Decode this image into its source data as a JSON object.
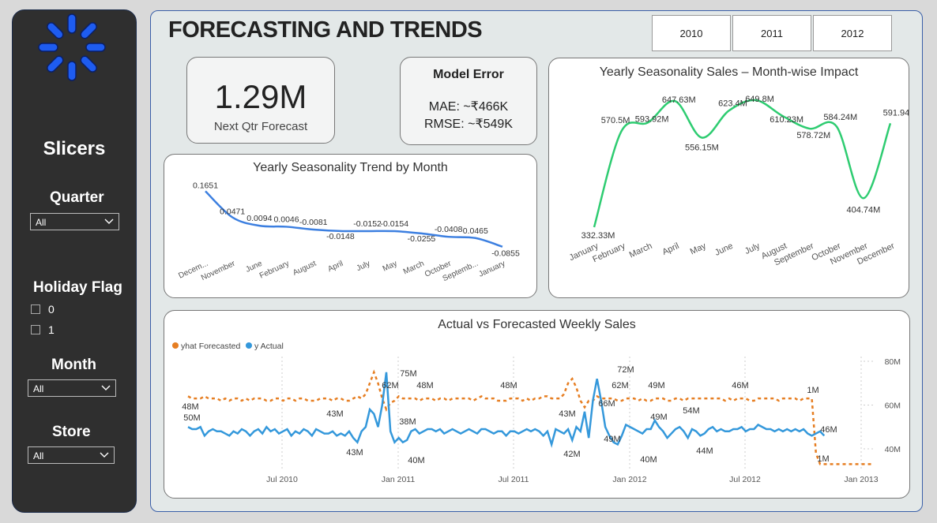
{
  "sidebar": {
    "title": "Slicers",
    "quarter": {
      "label": "Quarter",
      "value": "All"
    },
    "holiday": {
      "label": "Holiday Flag",
      "options": [
        "0",
        "1"
      ]
    },
    "month": {
      "label": "Month",
      "value": "All"
    },
    "store": {
      "label": "Store",
      "value": "All"
    }
  },
  "header": {
    "title": "FORECASTING AND TRENDS",
    "years": [
      "2010",
      "2011",
      "2012"
    ]
  },
  "kpi": {
    "value": "1.29M",
    "label": "Next Qtr Forecast"
  },
  "model_error": {
    "title": "Model Error",
    "mae": "MAE: ~₹466K",
    "rmse": "RMSE: ~₹549K"
  },
  "colors": {
    "accent_blue": "#3c7fe0",
    "green": "#2ecc71",
    "orange": "#e67e22",
    "actual_blue": "#3498db",
    "logo_blue": "#1e5cf0"
  },
  "chart_data": [
    {
      "type": "line",
      "title": "Yearly Seasonality Trend by Month",
      "categories": [
        "Decem...",
        "November",
        "June",
        "February",
        "August",
        "April",
        "July",
        "May",
        "March",
        "October",
        "Septemb...",
        "January"
      ],
      "values": [
        0.1651,
        0.0471,
        0.0094,
        0.0046,
        -0.0081,
        -0.0148,
        -0.0152,
        -0.0154,
        -0.0255,
        -0.0408,
        -0.0465,
        -0.0855
      ],
      "data_labels": [
        "0.1651",
        "0.0471",
        "0.0094",
        "0.0046",
        "-0.0081",
        "-0.0148",
        "-0.0152",
        "-0.0154",
        "-0.0255",
        "-0.0408",
        "0.0465",
        "-0.0855"
      ]
    },
    {
      "type": "line",
      "title": "Yearly Seasonality Sales – Month-wise Impact",
      "categories": [
        "January",
        "February",
        "March",
        "April",
        "May",
        "June",
        "July",
        "August",
        "September",
        "October",
        "November",
        "December"
      ],
      "values": [
        332.33,
        570.5,
        593.92,
        647.63,
        556.15,
        623.4,
        649.8,
        610.23,
        578.72,
        584.24,
        404.74,
        591.94
      ],
      "data_labels": [
        "332.33M",
        "570.5M",
        "593.92M",
        "647.63M",
        "556.15M",
        "623.4M",
        "649.8M",
        "610.23M",
        "578.72M",
        "584.24M",
        "404.74M",
        "591.94M"
      ]
    },
    {
      "type": "line",
      "title": "Actual vs Forecasted Weekly Sales",
      "legend": [
        "yhat Forecasted",
        "y Actual"
      ],
      "x_ticks": [
        "Jul 2010",
        "Jan 2011",
        "Jul 2011",
        "Jan 2012",
        "Jul 2012",
        "Jan 2013"
      ],
      "y_ticks_right": [
        "80M",
        "60M",
        "40M"
      ],
      "ylim": [
        35,
        82
      ],
      "series": [
        {
          "name": "yhat Forecasted",
          "values": [
            64,
            63,
            63,
            63,
            64,
            63,
            63,
            63,
            62,
            63,
            62,
            63,
            63,
            62,
            63,
            62,
            63,
            63,
            63,
            62,
            62,
            63,
            63,
            62,
            63,
            63,
            62,
            63,
            63,
            62,
            62,
            62,
            63,
            63,
            63,
            62,
            63,
            63,
            62,
            62,
            63,
            64,
            63,
            65,
            70,
            75,
            70,
            63,
            58,
            61,
            62,
            64,
            63,
            63,
            63,
            63,
            62,
            63,
            63,
            63,
            62,
            63,
            63,
            62,
            63,
            63,
            63,
            63,
            63,
            62,
            63,
            64,
            63,
            63,
            63,
            62,
            62,
            62,
            63,
            63,
            63,
            62,
            63,
            62,
            63,
            63,
            64,
            64,
            63,
            63,
            63,
            65,
            70,
            72,
            68,
            62,
            59,
            62,
            62,
            64,
            63,
            63,
            63,
            63,
            62,
            62,
            63,
            63,
            63,
            62,
            63,
            62,
            62,
            63,
            63,
            63,
            62,
            62,
            63,
            63,
            62,
            63,
            63,
            63,
            63,
            63,
            63,
            63,
            63,
            63,
            62,
            63,
            62,
            63,
            63,
            63,
            62,
            62,
            63,
            63,
            63,
            63,
            63,
            62,
            63,
            63,
            63,
            63,
            62,
            63,
            63,
            63,
            38,
            33,
            33,
            33,
            33,
            33,
            33,
            33,
            33,
            33,
            33,
            33,
            33,
            33,
            33
          ],
          "labels": [
            "48M",
            "43M",
            "62M",
            "48M",
            "48M",
            "43M",
            "66M",
            "62M",
            "49M",
            "49M",
            "46M",
            "1M",
            "1M"
          ]
        },
        {
          "name": "y Actual",
          "values": [
            50,
            49,
            49,
            50,
            46,
            48,
            49,
            48,
            48,
            47,
            46,
            48,
            47,
            49,
            48,
            46,
            48,
            49,
            47,
            50,
            48,
            49,
            47,
            48,
            49,
            46,
            48,
            47,
            49,
            48,
            46,
            49,
            48,
            47,
            47,
            48,
            46,
            47,
            46,
            48,
            45,
            43,
            48,
            50,
            58,
            56,
            50,
            60,
            75,
            48,
            43,
            45,
            43,
            44,
            48,
            49,
            47,
            48,
            49,
            49,
            48,
            49,
            47,
            48,
            49,
            48,
            47,
            48,
            49,
            48,
            47,
            49,
            49,
            48,
            47,
            48,
            48,
            46,
            48,
            48,
            47,
            48,
            49,
            48,
            49,
            48,
            46,
            48,
            42,
            49,
            48,
            47,
            49,
            44,
            50,
            48,
            57,
            45,
            62,
            72,
            62,
            50,
            46,
            43,
            42,
            46,
            51,
            50,
            49,
            48,
            47,
            49,
            49,
            53,
            50,
            48,
            45,
            47,
            49,
            50,
            48,
            45,
            49,
            48,
            46,
            47,
            49,
            50,
            48,
            49,
            48,
            48,
            49,
            49,
            50,
            48,
            49,
            49,
            51,
            50,
            49,
            49,
            48,
            49,
            48,
            49,
            48,
            49,
            48,
            49,
            47,
            46,
            47,
            48,
            46
          ],
          "labels": [
            "50M",
            "43M",
            "75M",
            "38M",
            "40M",
            "42M",
            "49M",
            "72M",
            "40M",
            "44M",
            "54M",
            "46M"
          ]
        }
      ]
    }
  ]
}
